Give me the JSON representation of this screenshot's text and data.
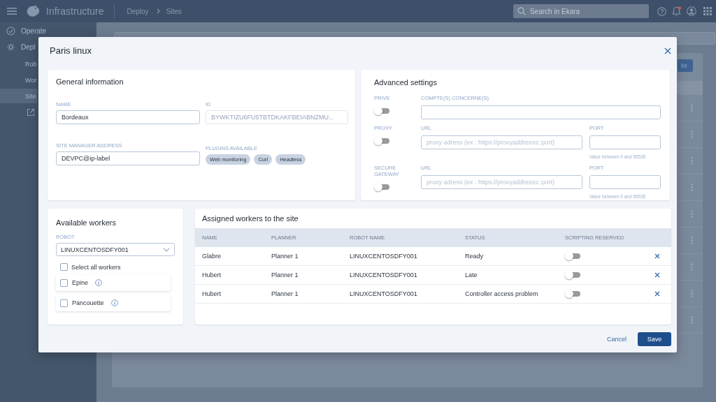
{
  "topbar": {
    "app_title": "Infrastructure",
    "breadcrumb": [
      "Deploy",
      "Sites"
    ],
    "search": {
      "placeholder": "Search in Ekara"
    }
  },
  "sidebar": {
    "items": [
      {
        "label": "Operate",
        "selected": false
      },
      {
        "label": "Depl",
        "selected": false,
        "children": [
          {
            "label": "Rob",
            "selected": false
          },
          {
            "label": "Wor",
            "selected": false
          },
          {
            "label": "Site",
            "selected": true
          }
        ]
      }
    ]
  },
  "main": {
    "action_button": "ite"
  },
  "modal": {
    "title": "Paris linux",
    "general": {
      "title": "General information",
      "fields": [
        {
          "label": "NAME",
          "value": "Bordeaux",
          "disabled": false
        },
        {
          "label": "ID",
          "value": "BYWKTIZU6FU5TBTDKAKFBEIABNZMU...",
          "disabled": true
        },
        {
          "label": "SITE MANAGER ADDRESS",
          "value": "DEVPC@ip-label",
          "disabled": false
        }
      ],
      "plugins_label": "PLUGINS AVAILABLE",
      "plugins": [
        "Web monitoring",
        "Curl",
        "Headless"
      ]
    },
    "advanced": {
      "title": "Advanced settings",
      "rows": [
        {
          "label": "PRIVE",
          "on": false,
          "fields": [
            {
              "label": "COMPTE(S) CONCERNE(S)"
            }
          ]
        },
        {
          "label": "PROXY",
          "on": false,
          "fields": [
            {
              "label": "URL",
              "placeholder": "proxy adress (ex : https://proxyaddresss::port)"
            },
            {
              "label": "PORT",
              "hint": "Value between 0 and 65535"
            }
          ]
        },
        {
          "label": "SECURE GATEWAY",
          "on": false,
          "fields": [
            {
              "label": "URL",
              "placeholder": "proxy adress (ex : https://proxyaddresss::port)"
            },
            {
              "label": "PORT",
              "hint": "Value between 0 and 65535"
            }
          ]
        }
      ]
    },
    "available": {
      "title": "Available workers",
      "robot_label": "ROBOT",
      "robot_value": "LINUXCENTOSDFY001",
      "select_all": {
        "label": "Select all workers",
        "checked": false
      },
      "workers": [
        {
          "name": "Epine",
          "checked": false
        },
        {
          "name": "Pancouette",
          "checked": false
        }
      ]
    },
    "assigned": {
      "title": "Assigned workers to the site",
      "columns": [
        "NAME",
        "PLANNER",
        "ROBOT NAME",
        "STATUS",
        "SCRIPTING RESERVED"
      ],
      "rows": [
        {
          "name": "Glabre",
          "planner": "Planner 1",
          "robot": "LINUXCENTOSDFY001",
          "status": "Ready",
          "scripting_reserved": false
        },
        {
          "name": "Hubert",
          "planner": "Planner 1",
          "robot": "LINUXCENTOSDFY001",
          "status": "Late",
          "scripting_reserved": false
        },
        {
          "name": "Hubert",
          "planner": "Planner 1",
          "robot": "LINUXCENTOSDFY001",
          "status": "Controller access problem",
          "scripting_reserved": false
        }
      ]
    },
    "buttons": {
      "cancel": "Cancel",
      "save": "Save"
    }
  }
}
